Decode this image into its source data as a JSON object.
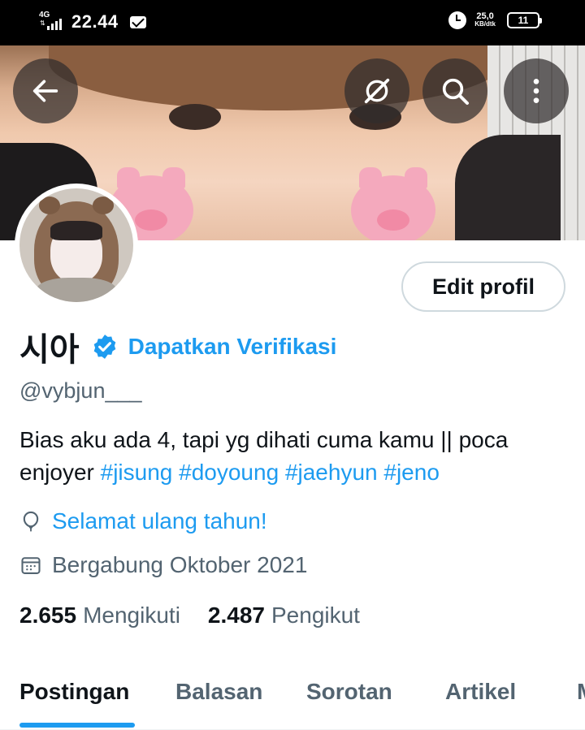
{
  "status_bar": {
    "network": "4G",
    "time": "22.44",
    "speed_value": "25,0",
    "speed_unit": "KB/dtk",
    "battery": "11"
  },
  "header": {
    "back_icon": "arrow-left-icon",
    "grok_icon": "grok-icon",
    "search_icon": "search-icon",
    "more_icon": "more-vertical-icon"
  },
  "profile": {
    "edit_label": "Edit profil",
    "display_name": "시아",
    "verify_label": "Dapatkan Verifikasi",
    "handle": "@vybjun___",
    "bio": {
      "text": "Bias aku ada 4, tapi yg dihati cuma kamu || poca enjoyer",
      "hashtags": [
        "#jisung",
        "#doyoung",
        "#jaehyun",
        "#jeno"
      ]
    },
    "birthday_label": "Selamat ulang tahun!",
    "joined_label": "Bergabung Oktober 2021",
    "following_count": "2.655",
    "following_label": "Mengikuti",
    "followers_count": "2.487",
    "followers_label": "Pengikut"
  },
  "tabs": [
    {
      "label": "Postingan",
      "active": true
    },
    {
      "label": "Balasan",
      "active": false
    },
    {
      "label": "Sorotan",
      "active": false
    },
    {
      "label": "Artikel",
      "active": false
    },
    {
      "label": "M",
      "active": false
    }
  ],
  "colors": {
    "accent": "#1d9bf0",
    "text_primary": "#0f1419",
    "text_secondary": "#536471"
  }
}
